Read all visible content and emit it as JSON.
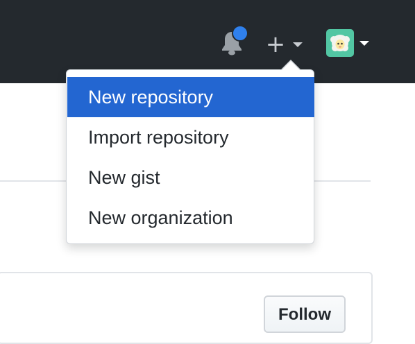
{
  "header": {
    "notification_icon": "bell-icon",
    "notification_indicator_color": "#2f80ed",
    "create_icon": "plus-icon",
    "create_caret_icon": "caret-down-icon",
    "avatar_icon": "sheep-avatar",
    "avatar_caret_icon": "caret-down-icon",
    "background_color": "#24292e"
  },
  "menu": {
    "items": [
      {
        "label": "New repository",
        "active": true
      },
      {
        "label": "Import repository",
        "active": false
      },
      {
        "label": "New gist",
        "active": false
      },
      {
        "label": "New organization",
        "active": false
      }
    ],
    "active_color": "#2366d1"
  },
  "profile": {
    "follow_label": "Follow"
  }
}
